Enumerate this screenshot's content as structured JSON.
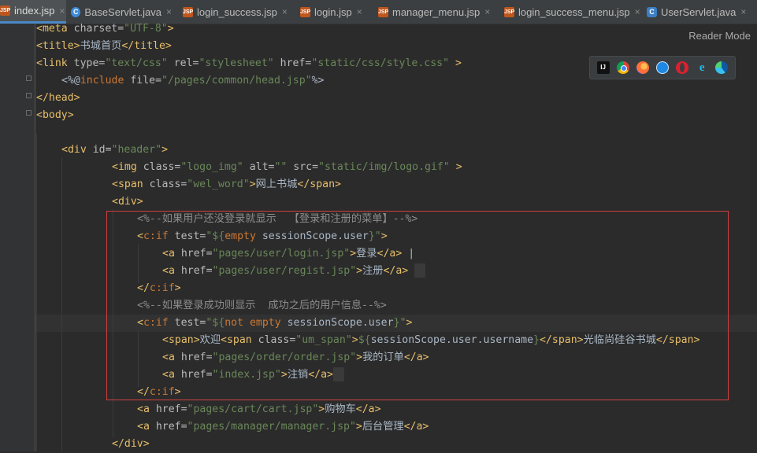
{
  "tabs": [
    {
      "label": "index.jsp",
      "icon": "jsp-file-icon",
      "active": true
    },
    {
      "label": "BaseServlet.java",
      "icon": "class-file-icon",
      "active": false
    },
    {
      "label": "login_success.jsp",
      "icon": "jsp-file-icon",
      "active": false
    },
    {
      "label": "login.jsp",
      "icon": "jsp-file-icon",
      "active": false
    },
    {
      "label": "manager_menu.jsp",
      "icon": "jsp-file-icon",
      "active": false
    },
    {
      "label": "login_success_menu.jsp",
      "icon": "jsp-file-icon",
      "active": false
    },
    {
      "label": "UserServlet.java",
      "icon": "servlet-class-icon",
      "active": false
    }
  ],
  "reader_mode": "Reader Mode",
  "icon_glyphs": {
    "jsp": "JSP",
    "cls": "C",
    "srv": "C",
    "close": "×",
    "ij": "IJ",
    "ie": "e"
  },
  "browsers": [
    "intellij-icon",
    "chrome-icon",
    "firefox-icon",
    "safari-icon",
    "opera-icon",
    "ie-icon",
    "edge-icon"
  ],
  "code": {
    "l1": {
      "a": "<meta",
      "b": " charset=",
      "c": "\"UTF-8\"",
      "d": ">"
    },
    "l2": {
      "a": "<title>",
      "b": "书城首页",
      "c": "</title>"
    },
    "l3": {
      "a": "<link",
      "b": " type=",
      "c": "\"text/css\"",
      "d": " rel=",
      "e": "\"stylesheet\"",
      "f": " href=",
      "g": "\"static/css/style.css\"",
      "h": " >"
    },
    "l4": {
      "a": "<%@",
      "b": "include",
      "c": " file=",
      "d": "\"/pages/common/head.jsp\"",
      "e": "%>"
    },
    "l5": "</head>",
    "l6": "<body>",
    "l8": {
      "a": "<div",
      "b": " id=",
      "c": "\"header\"",
      "d": ">"
    },
    "l9": {
      "a": "<img",
      "b": " class=",
      "c": "\"logo_img\"",
      "d": " alt=",
      "e": "\"\"",
      "f": " src=",
      "g": "\"static/img/logo.gif\"",
      "h": " >"
    },
    "l10": {
      "a": "<span",
      "b": " class=",
      "c": "\"wel_word\"",
      "d": ">",
      "e": "网上书城",
      "f": "</span>"
    },
    "l11": "<div>",
    "l12": "<%--如果用户还没登录就显示  【登录和注册的菜单】--%>",
    "l13": {
      "a": "<",
      "b": "c:if",
      "c": " test=",
      "d": "\"${",
      "e": "empty ",
      "f": "sessionScope.user",
      "g": "}\"",
      "h": ">"
    },
    "l14": {
      "a": "<a",
      "b": " href=",
      "c": "\"pages/user/login.jsp\"",
      "d": ">",
      "e": "登录",
      "f": "</a>",
      "g": " |"
    },
    "l15": {
      "a": "<a",
      "b": " href=",
      "c": "\"pages/user/regist.jsp\"",
      "d": ">",
      "e": "注册",
      "f": "</a>"
    },
    "l16": {
      "a": "</",
      "b": "c:if",
      "c": ">"
    },
    "l17": "<%--如果登录成功则显示  成功之后的用户信息--%>",
    "l18": {
      "a": "<",
      "b": "c:if",
      "c": " test=",
      "d": "\"${",
      "e": "not empty ",
      "f": "sessionScope.user",
      "g": "}\"",
      "h": ">"
    },
    "l19": {
      "a": "<span>",
      "b": "欢迎",
      "c": "<span",
      "d": " class=",
      "e": "\"um_span\"",
      "f": ">",
      "g": "${",
      "h": "sessionScope.user.username",
      "i": "}",
      "j": "</span>",
      "k": "光临尚硅谷书城",
      "l": "</span>"
    },
    "l20": {
      "a": "<a",
      "b": " href=",
      "c": "\"pages/order/order.jsp\"",
      "d": ">",
      "e": "我的订单",
      "f": "</a>"
    },
    "l21": {
      "a": "<a",
      "b": " href=",
      "c": "\"index.jsp\"",
      "d": ">",
      "e": "注销",
      "f": "</a>"
    },
    "l22": {
      "a": "</",
      "b": "c:if",
      "c": ">"
    },
    "l23": {
      "a": "<a",
      "b": " href=",
      "c": "\"pages/cart/cart.jsp\"",
      "d": ">",
      "e": "购物车",
      "f": "</a>"
    },
    "l24": {
      "a": "<a",
      "b": " href=",
      "c": "\"pages/manager/manager.jsp\"",
      "d": ">",
      "e": "后台管理",
      "f": "</a>"
    },
    "l25": "</div>"
  }
}
